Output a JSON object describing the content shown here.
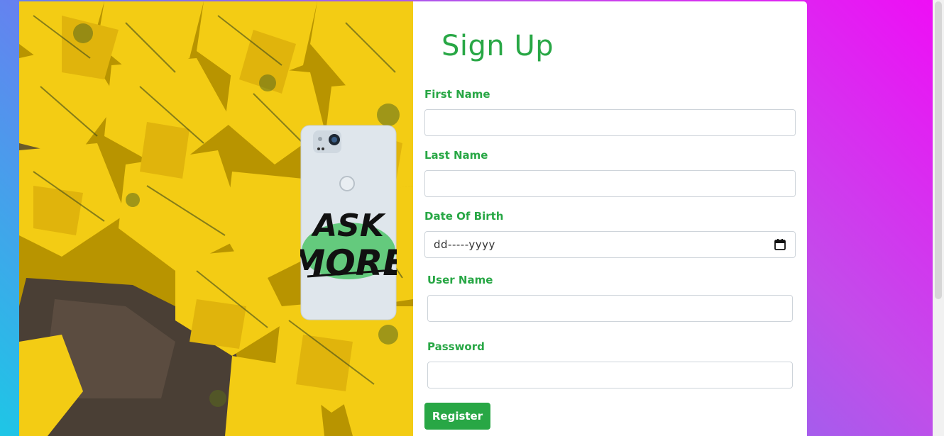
{
  "form": {
    "title": "Sign Up",
    "fields": {
      "first_name": {
        "label": "First Name",
        "value": ""
      },
      "last_name": {
        "label": "Last Name",
        "value": ""
      },
      "dob": {
        "label": "Date Of Birth",
        "value": "dd-----yyyy"
      },
      "username": {
        "label": "User Name",
        "value": ""
      },
      "password": {
        "label": "Password",
        "value": ""
      }
    },
    "register_label": "Register"
  },
  "image": {
    "phone_text_line1": "ASK",
    "phone_text_line2": "MORE"
  },
  "colors": {
    "accent": "#28a745",
    "leaves": "#f2c812",
    "phone": "#dfe6ec"
  }
}
